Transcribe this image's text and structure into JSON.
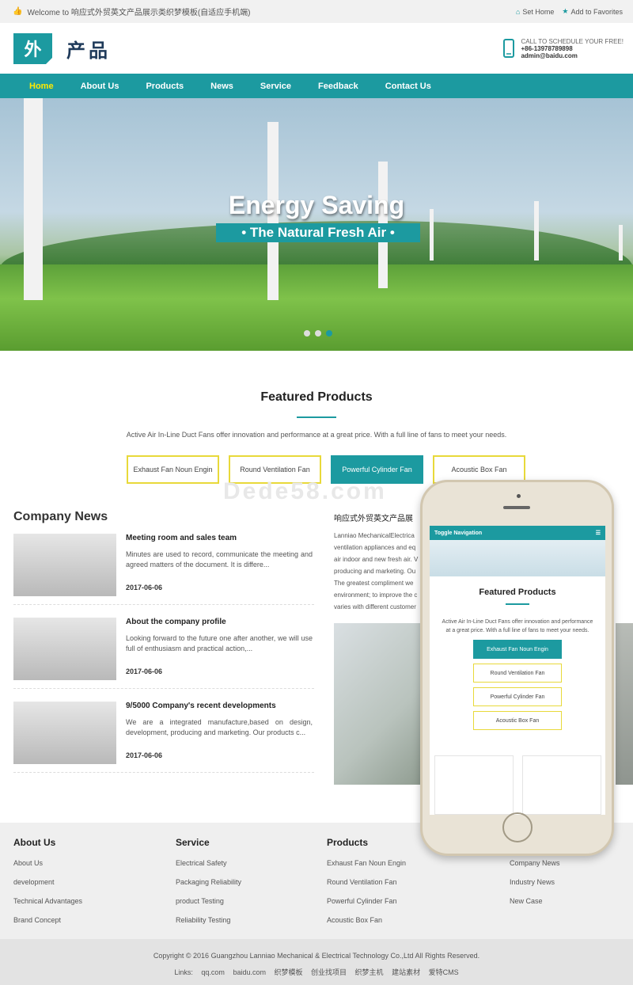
{
  "topbar": {
    "welcome": "Welcome to 响应式外贸英文产品展示类织梦模板(自适应手机端)",
    "set_home": "Set Home",
    "favorites": "Add to Favorites"
  },
  "header": {
    "logo_char": "外",
    "logo_text": "产品",
    "contact_label": "CALL TO SCHEDULE YOUR FREE!",
    "phone": "+86-13978789898",
    "email": "admin@baidu.com"
  },
  "nav": {
    "items": [
      "Home",
      "About Us",
      "Products",
      "News",
      "Service",
      "Feedback",
      "Contact Us"
    ]
  },
  "hero": {
    "title": "Energy Saving",
    "subtitle": "• The Natural Fresh Air •"
  },
  "featured": {
    "title": "Featured Products",
    "desc": "Active Air In-Line Duct Fans offer innovation and performance at a great price. With a full line of fans to meet your needs.",
    "tabs": [
      "Exhaust Fan Noun Engin",
      "Round Ventilation Fan",
      "Powerful Cylinder Fan",
      "Acoustic Box Fan"
    ]
  },
  "watermark": "Dede58.com",
  "news": {
    "title": "Company News",
    "items": [
      {
        "title": "Meeting room and sales team",
        "desc": "Minutes are used to record, communicate the meeting and agreed matters of the document. It is differe...",
        "date": "2017-06-06"
      },
      {
        "title": "About the company profile",
        "desc": "Looking forward to the future one after another, we will use full of enthusiasm and practical action,...",
        "date": "2017-06-06"
      },
      {
        "title": "9/5000 Company's recent developments",
        "desc": "We are a integrated manufacture,based on design, development, producing and marketing. Our products c...",
        "date": "2017-06-06"
      }
    ]
  },
  "about": {
    "title": "响应式外贸英文产品展",
    "lines": [
      "Lanniao MechanicalElectrica",
      "ventilation appliances and eq",
      "air indoor and new fresh air. V",
      "producing and marketing. Ou",
      "The greatest compliment we",
      "environment; to improve the c",
      "varies with different customer"
    ]
  },
  "phone": {
    "nav_label": "Toggle Navigation",
    "title": "Featured Products",
    "desc": "Active Air In-Line Duct Fans offer innovation and performance at a great price. With a full line of fans to meet your needs.",
    "tabs": [
      "Exhaust Fan Noun Engin",
      "Round Ventilation Fan",
      "Powerful Cylinder Fan",
      "Acoustic Box Fan"
    ]
  },
  "footer": {
    "about": {
      "title": "About Us",
      "links": [
        "About Us",
        "development",
        "Technical Advantages",
        "Brand Concept"
      ]
    },
    "service": {
      "title": "Service",
      "links": [
        "Electrical Safety",
        "Packaging Reliability",
        "product Testing",
        "Reliability Testing"
      ]
    },
    "products": {
      "title": "Products",
      "links": [
        "Exhaust Fan Noun Engin",
        "Round Ventilation Fan",
        "Powerful Cylinder Fan",
        "Acoustic Box Fan"
      ]
    },
    "news": {
      "links": [
        "Company News",
        "Industry News",
        "New Case"
      ]
    }
  },
  "copyright": "Copyright © 2016 Guangzhou Lanniao Mechanical & Electrical Technology Co.,Ltd All Rights Reserved.",
  "links": {
    "label": "Links:",
    "items": [
      "qq.com",
      "baidu.com",
      "织梦模板",
      "创业找项目",
      "织梦主机",
      "建站素材",
      "爱特CMS"
    ]
  },
  "colors": {
    "accent": "#1c9aa0",
    "highlight": "#ffea00",
    "tab_border": "#e8d93a"
  }
}
